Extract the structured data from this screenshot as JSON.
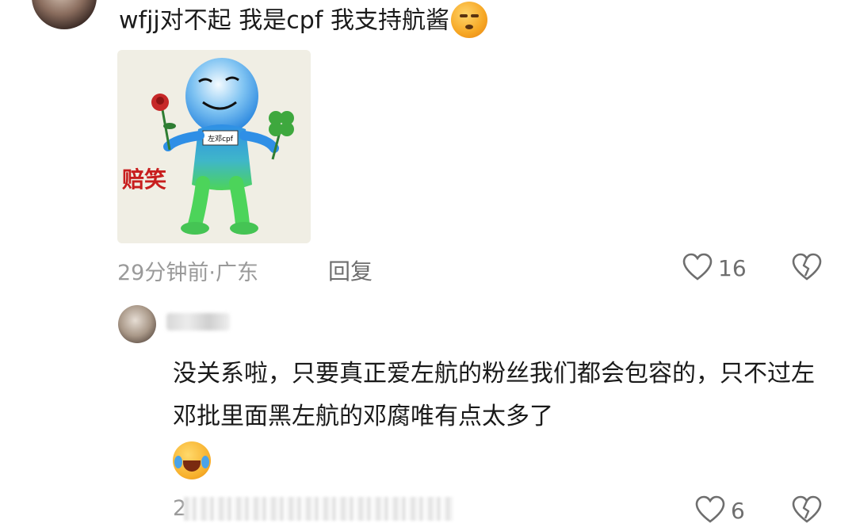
{
  "top_comment": {
    "text": "wfjj对不起 我是cpf 我支持航酱",
    "emoji": "unamused-face-emoji",
    "sticker": {
      "badge": "左邓cpf",
      "caption": "赔笑"
    },
    "time": "29分钟前",
    "separator": "·",
    "location": "广东",
    "reply_label": "回复",
    "like_count": "16"
  },
  "reply": {
    "text": "没关系啦，只要真正爱左航的粉丝我们都会包容的，只不过左邓批里面黑左航的邓腐唯有点太多了",
    "emoji": "crying-laughing-emoji",
    "time_visible": "2",
    "like_count": "6"
  },
  "colors": {
    "text": "#1a1a1a",
    "meta": "#9a9a9a",
    "icon": "#6e6e6e",
    "accent_red": "#c81e1e"
  }
}
